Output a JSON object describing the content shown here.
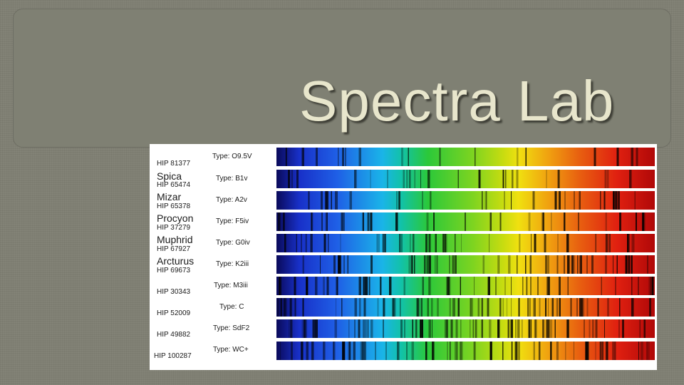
{
  "slide": {
    "title": "Spectra Lab"
  },
  "figure": {
    "rows": [
      {
        "hip": "HIP 81377",
        "name": "",
        "type": "Type: O9.5V"
      },
      {
        "hip": "HIP 65474",
        "name": "Spica",
        "type": "Type: B1v"
      },
      {
        "hip": "HIP 65378",
        "name": "Mizar",
        "type": "Type: A2v"
      },
      {
        "hip": "HIP 37279",
        "name": "Procyon",
        "type": "Type: F5iv"
      },
      {
        "hip": "HIP 67927",
        "name": "Muphrid",
        "type": "Type: G0iv"
      },
      {
        "hip": "HIP 69673",
        "name": "Arcturus",
        "type": "Type: K2iii"
      },
      {
        "hip": "HIP 30343",
        "name": "",
        "type": "Type: M3iii"
      },
      {
        "hip": "HIP 52009",
        "name": "",
        "type": "Type: C"
      },
      {
        "hip": "HIP 49882",
        "name": "",
        "type": "Type: SdF2"
      },
      {
        "hip": "HIP 100287",
        "name": "",
        "type": "Type: WC+"
      }
    ]
  }
}
